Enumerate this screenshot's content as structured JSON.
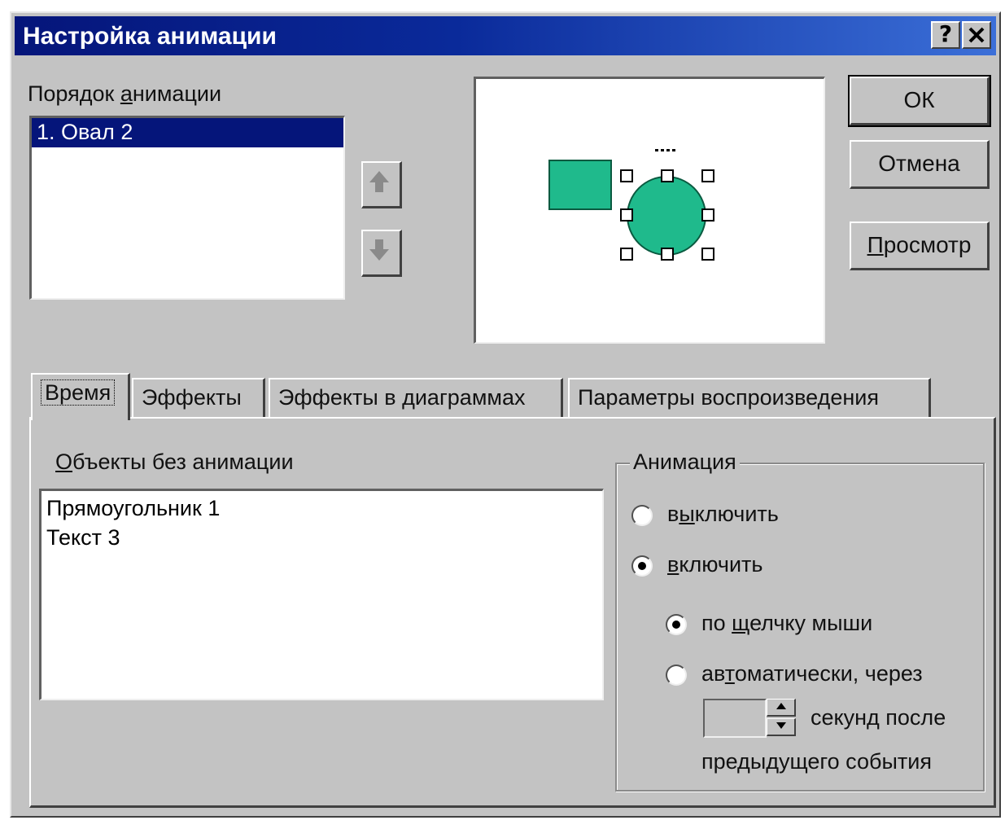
{
  "window": {
    "title": "Настройка анимации",
    "help_label": "?",
    "close_label": "✕"
  },
  "order": {
    "label_pre": "Порядок ",
    "label_ul": "а",
    "label_post": "нимации",
    "items": [
      "1. Овал 2"
    ],
    "selected_index": 0
  },
  "buttons": {
    "ok": "ОК",
    "cancel": "Отмена",
    "preview_ul": "П",
    "preview_rest": "росмотр"
  },
  "icons": {
    "move_up": "arrow-up-icon",
    "move_down": "arrow-down-icon"
  },
  "colors": {
    "shape_fill": "#1fba8c",
    "selection": "#05157a",
    "title_start": "#05157a"
  },
  "tabs": [
    {
      "label": "Время",
      "active": true
    },
    {
      "label": "Эффекты",
      "active": false
    },
    {
      "label": "Эффекты в диаграммах",
      "active": false
    },
    {
      "label": "Параметры воспроизведения",
      "active": false
    }
  ],
  "time_panel": {
    "objects_label_ul": "О",
    "objects_label_rest": "бъекты без анимации",
    "objects": [
      "Прямоугольник 1",
      "Текст 3"
    ],
    "animation_group": {
      "legend": "Анимация",
      "off_pre": "в",
      "off_ul": "ы",
      "off_post": "ключить",
      "on_pre": "",
      "on_ul": "в",
      "on_post": "ключить",
      "click_pre": "по ",
      "click_ul": "щ",
      "click_post": "елчку мыши",
      "auto_pre": "ав",
      "auto_ul": "т",
      "auto_post": "оматически, через",
      "seconds_after": "секунд после",
      "previous_event": "предыдущего события",
      "seconds_value": "",
      "selected": "on",
      "sub_selected": "click"
    }
  }
}
